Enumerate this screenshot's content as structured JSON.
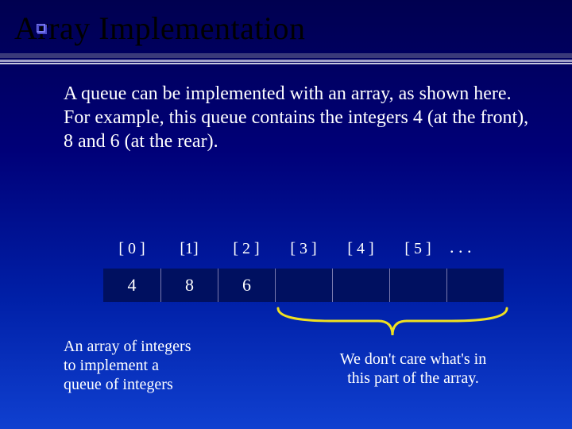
{
  "title": "Array Implementation",
  "bullet_text": "A queue can be implemented with an array, as shown here.  For example, this queue contains the integers 4 (at the front), 8 and 6 (at the rear).",
  "indices": [
    "[ 0 ]",
    "[1]",
    "[ 2 ]",
    "[ 3 ]",
    "[ 4 ]",
    "[ 5 ]"
  ],
  "ellipsis": ". . .",
  "cells": [
    "4",
    "8",
    "6",
    "",
    "",
    "",
    ""
  ],
  "caption_left_lines": [
    "An array of integers",
    "to implement a",
    "queue of integers"
  ],
  "caption_right_lines": [
    "We don't care what's in",
    "this part of the array."
  ],
  "chart_data": {
    "type": "table",
    "title": "Array Implementation",
    "columns": [
      "[ 0 ]",
      "[1]",
      "[ 2 ]",
      "[ 3 ]",
      "[ 4 ]",
      "[ 5 ]"
    ],
    "values": [
      4,
      8,
      6,
      null,
      null,
      null
    ],
    "annotations": {
      "left": "An array of integers to implement a queue of integers",
      "right": "We don't care what's in this part of the array."
    }
  }
}
